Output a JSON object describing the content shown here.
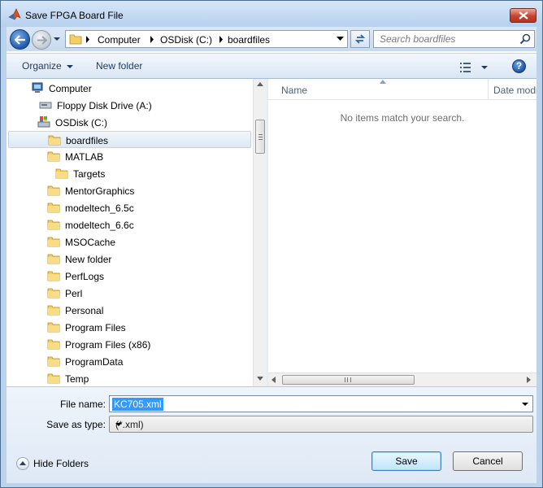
{
  "window": {
    "title": "Save FPGA Board File"
  },
  "nav": {
    "breadcrumbs": [
      "Computer",
      "OSDisk (C:)",
      "boardfiles"
    ],
    "search_placeholder": "Search boardfiles"
  },
  "toolbar": {
    "organize_label": "Organize",
    "new_folder_label": "New folder",
    "help_label": "?"
  },
  "tree": {
    "items": [
      {
        "label": "Computer",
        "icon": "computer-icon"
      },
      {
        "label": "Floppy Disk Drive (A:)",
        "icon": "floppy-icon"
      },
      {
        "label": "OSDisk (C:)",
        "icon": "drive-icon"
      },
      {
        "label": "boardfiles",
        "icon": "folder-icon",
        "selected": true
      },
      {
        "label": "MATLAB",
        "icon": "folder-icon"
      },
      {
        "label": "Targets",
        "icon": "folder-icon"
      },
      {
        "label": "MentorGraphics",
        "icon": "folder-icon"
      },
      {
        "label": "modeltech_6.5c",
        "icon": "folder-icon"
      },
      {
        "label": "modeltech_6.6c",
        "icon": "folder-icon"
      },
      {
        "label": "MSOCache",
        "icon": "folder-icon"
      },
      {
        "label": "New folder",
        "icon": "folder-icon"
      },
      {
        "label": "PerfLogs",
        "icon": "folder-icon"
      },
      {
        "label": "Perl",
        "icon": "folder-icon"
      },
      {
        "label": "Personal",
        "icon": "folder-icon"
      },
      {
        "label": "Program Files",
        "icon": "folder-icon"
      },
      {
        "label": "Program Files (x86)",
        "icon": "folder-icon"
      },
      {
        "label": "ProgramData",
        "icon": "folder-icon"
      },
      {
        "label": "Temp",
        "icon": "folder-icon"
      }
    ]
  },
  "list": {
    "columns": [
      "Name",
      "Date modi"
    ],
    "empty_message": "No items match your search."
  },
  "form": {
    "file_name_label": "File name:",
    "file_name_value": "KC705.xml",
    "save_type_label": "Save as type:",
    "save_type_value": "(*.xml)"
  },
  "footer": {
    "hide_folders_label": "Hide Folders",
    "save_label": "Save",
    "cancel_label": "Cancel"
  },
  "colors": {
    "accent": "#3399ff",
    "frame": "#bcd3ec",
    "close": "#c7432f"
  }
}
